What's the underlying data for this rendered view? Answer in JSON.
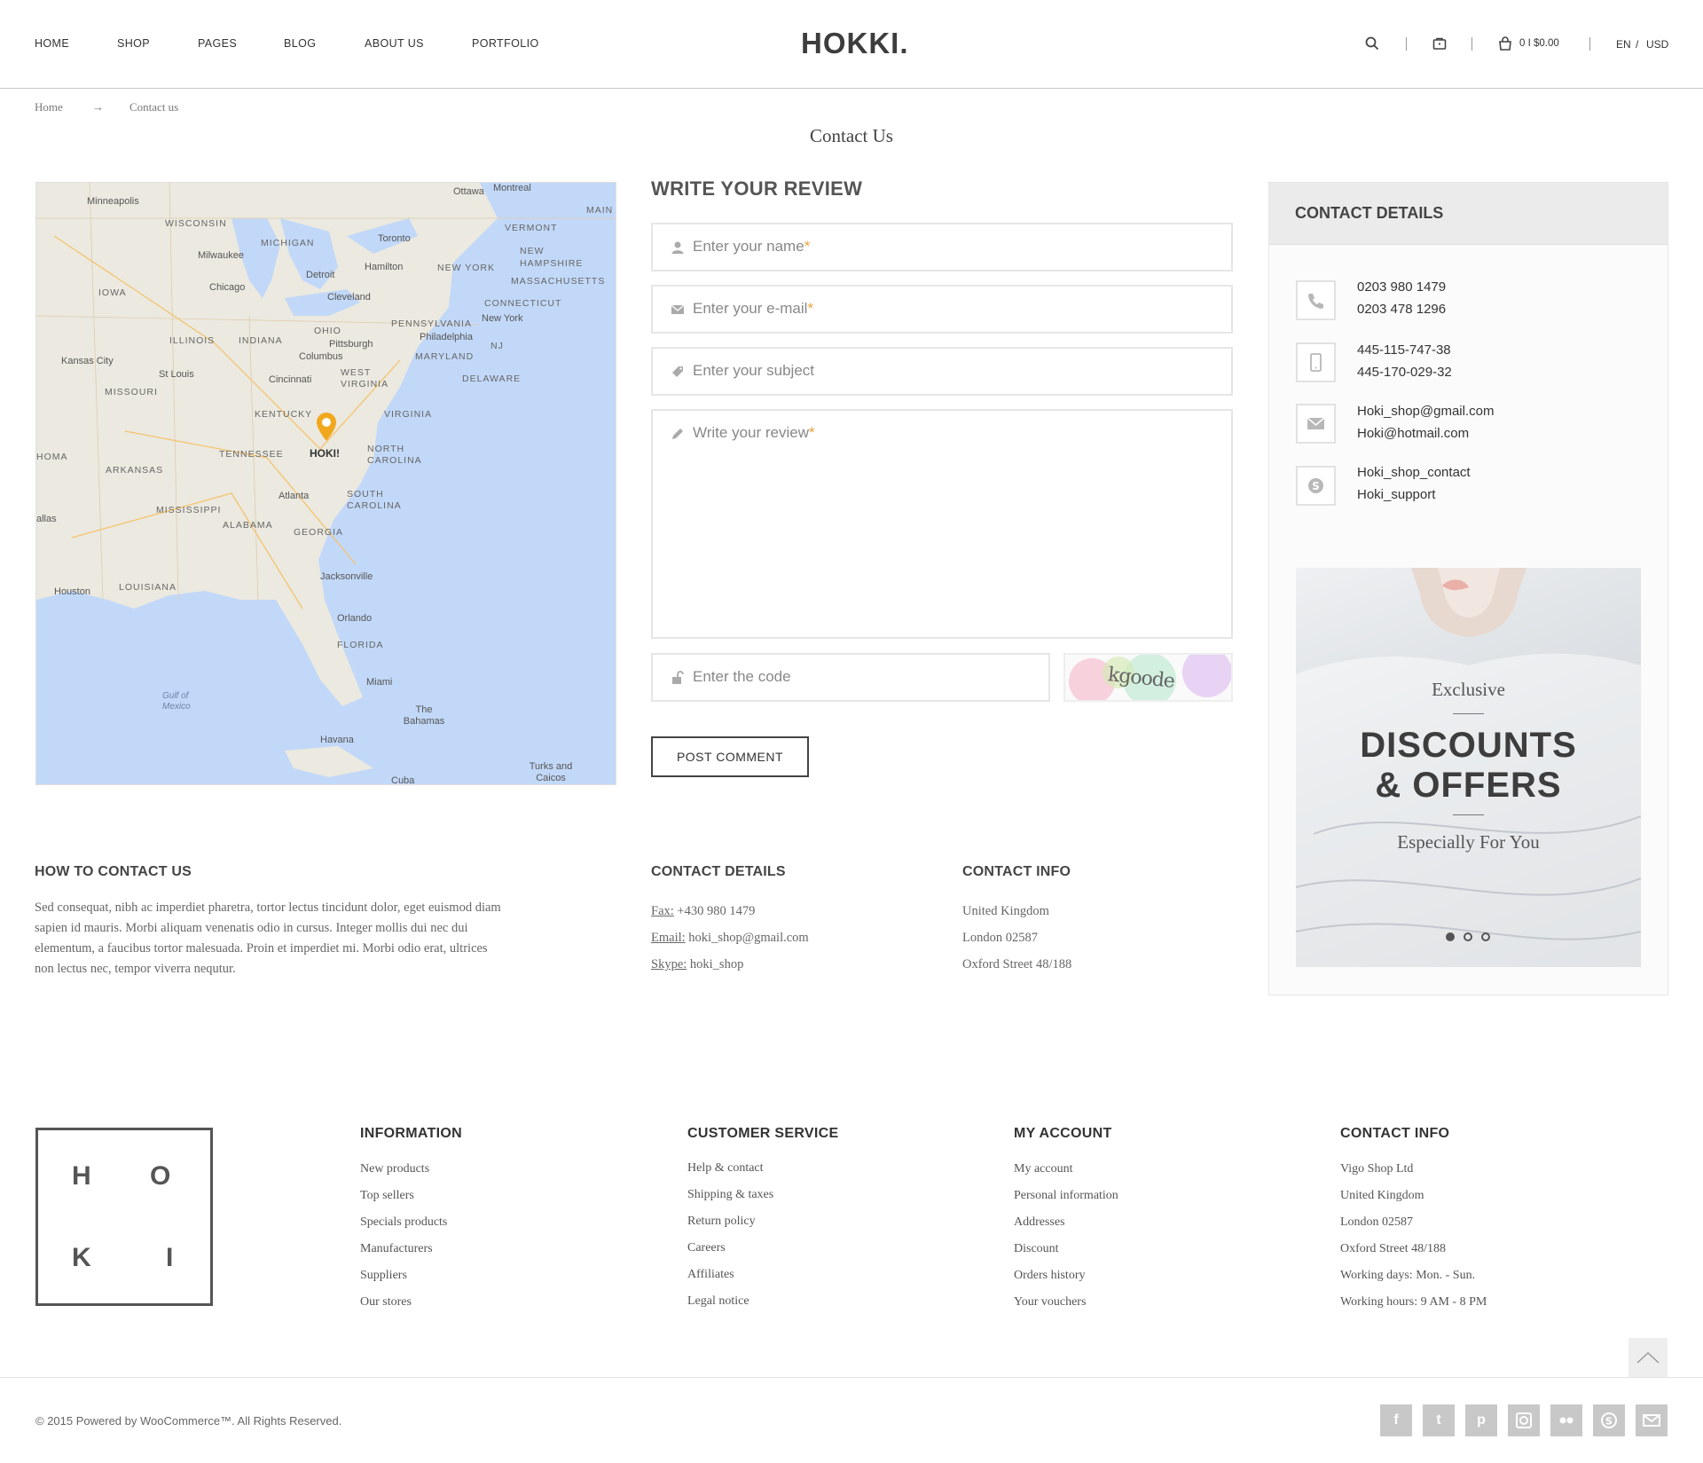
{
  "header": {
    "nav": [
      "HOME",
      "SHOP",
      "PAGES",
      "BLOG",
      "ABOUT US",
      "PORTFOLIO"
    ],
    "logo": "HOKKI.",
    "cart": "0 I $0.00",
    "lang": "EN",
    "lang_sep": "/",
    "currency": "USD"
  },
  "breadcrumb": {
    "home": "Home",
    "arrow": "→",
    "current": "Contact us"
  },
  "page_title": "Contact Us",
  "map": {
    "marker_label": "HOKI!",
    "places": [
      "Ottawa",
      "Montreal",
      "MAIN",
      "Minneapolis",
      "WISCONSIN",
      "VERMONT",
      "MICHIGAN",
      "Toronto",
      "NEW HAMPSHIRE",
      "Milwaukee",
      "Hamilton",
      "NEW YORK",
      "MASSACHUSETTS",
      "IOWA",
      "Chicago",
      "Detroit",
      "Cleveland",
      "CONNECTICUT",
      "New York",
      "PENNSYLVANIA",
      "OHIO",
      "ILLINOIS",
      "INDIANA",
      "Pittsburgh",
      "Philadelphia",
      "NJ",
      "Kansas City",
      "Columbus",
      "MARYLAND",
      "St Louis",
      "Cincinnati",
      "WEST VIRGINIA",
      "DELAWARE",
      "MISSOURI",
      "KENTUCKY",
      "VIRGINIA",
      "HOMA",
      "TENNESSEE",
      "NORTH CAROLINA",
      "ARKANSAS",
      "Atlanta",
      "SOUTH CAROLINA",
      "MISSISSIPPI",
      "allas",
      "ALABAMA",
      "GEORGIA",
      "Jacksonville",
      "Houston",
      "LOUISIANA",
      "Orlando",
      "FLORIDA",
      "Gulf of Mexico",
      "Miami",
      "The Bahamas",
      "Havana",
      "Turks and Caicos",
      "Cuba"
    ]
  },
  "form": {
    "heading": "WRITE YOUR REVIEW",
    "name_ph": "Enter your name",
    "email_ph": "Enter your e-mail",
    "subject_ph": "Enter your subject",
    "review_ph": "Write your review",
    "req_mark": "*",
    "code_ph": "Enter the code",
    "captcha_text": "kgoode",
    "submit": "POST COMMENT"
  },
  "sidebar": {
    "heading": "CONTACT DETAILS",
    "phones": [
      "0203 980 1479",
      "0203 478 1296"
    ],
    "mobiles": [
      "445-115-747-38",
      "445-170-029-32"
    ],
    "emails": [
      "Hoki_shop@gmail.com",
      "Hoki@hotmail.com"
    ],
    "skype": [
      "Hoki_shop_contact",
      "Hoki_support"
    ],
    "promo": {
      "line1": "Exclusive",
      "line2": "DISCOUNTS",
      "line3": "& OFFERS",
      "line4": "Especially For You"
    }
  },
  "how_to": {
    "heading": "HOW TO CONTACT US",
    "lines": [
      "Sed consequat, nibh ac imperdiet pharetra, tortor lectus tincidunt dolor, eget euismod diam",
      "sapien id mauris. Morbi aliquam venenatis odio in cursus. Integer mollis dui nec dui",
      "elementum, a faucibus tortor malesuada. Proin et imperdiet mi. Morbi odio erat, ultrices",
      "non lectus nec, tempor viverra nequtur."
    ]
  },
  "contact_details": {
    "heading": "CONTACT DETAILS",
    "fax_label": "Fax:",
    "fax": "+430 980 1479",
    "email_label": "Email:",
    "email": "hoki_shop@gmail.com",
    "skype_label": "Skype:",
    "skype": "hoki_shop"
  },
  "contact_info": {
    "heading": "CONTACT INFO",
    "lines": [
      "United Kingdom",
      "London 02587",
      "Oxford Street 48/188"
    ]
  },
  "footer": {
    "logo_letters": [
      "H",
      "O",
      "K",
      "I"
    ],
    "columns": [
      {
        "heading": "INFORMATION",
        "items": [
          "New products",
          "Top sellers",
          "Specials products",
          "Manufacturers",
          "Suppliers",
          "Our stores"
        ]
      },
      {
        "heading": "CUSTOMER SERVICE",
        "items": [
          "Help & contact",
          "Shipping & taxes",
          "Return policy",
          "Careers",
          "Affiliates",
          "Legal notice"
        ]
      },
      {
        "heading": "MY ACCOUNT",
        "items": [
          "My account",
          "Personal information",
          "Addresses",
          "Discount",
          "Orders history",
          "Your vouchers"
        ]
      },
      {
        "heading": "CONTACT INFO",
        "items": [
          "Vigo Shop Ltd",
          "United Kingdom",
          "London 02587",
          "Oxford Street 48/188",
          "Working days: Mon. - Sun.",
          "Working hours: 9 AM - 8 PM"
        ]
      }
    ],
    "copyright": "© 2015 Powered by WooCommerce™. All Rights Reserved.",
    "social": [
      "facebook-icon",
      "tumblr-icon",
      "pinterest-icon",
      "instagram-icon",
      "flickr-icon",
      "skype-icon",
      "mail-icon"
    ]
  },
  "colors": {
    "accent": "#e8a33a",
    "map_water": "#c2d8f8",
    "map_land": "#ebe9e0"
  }
}
